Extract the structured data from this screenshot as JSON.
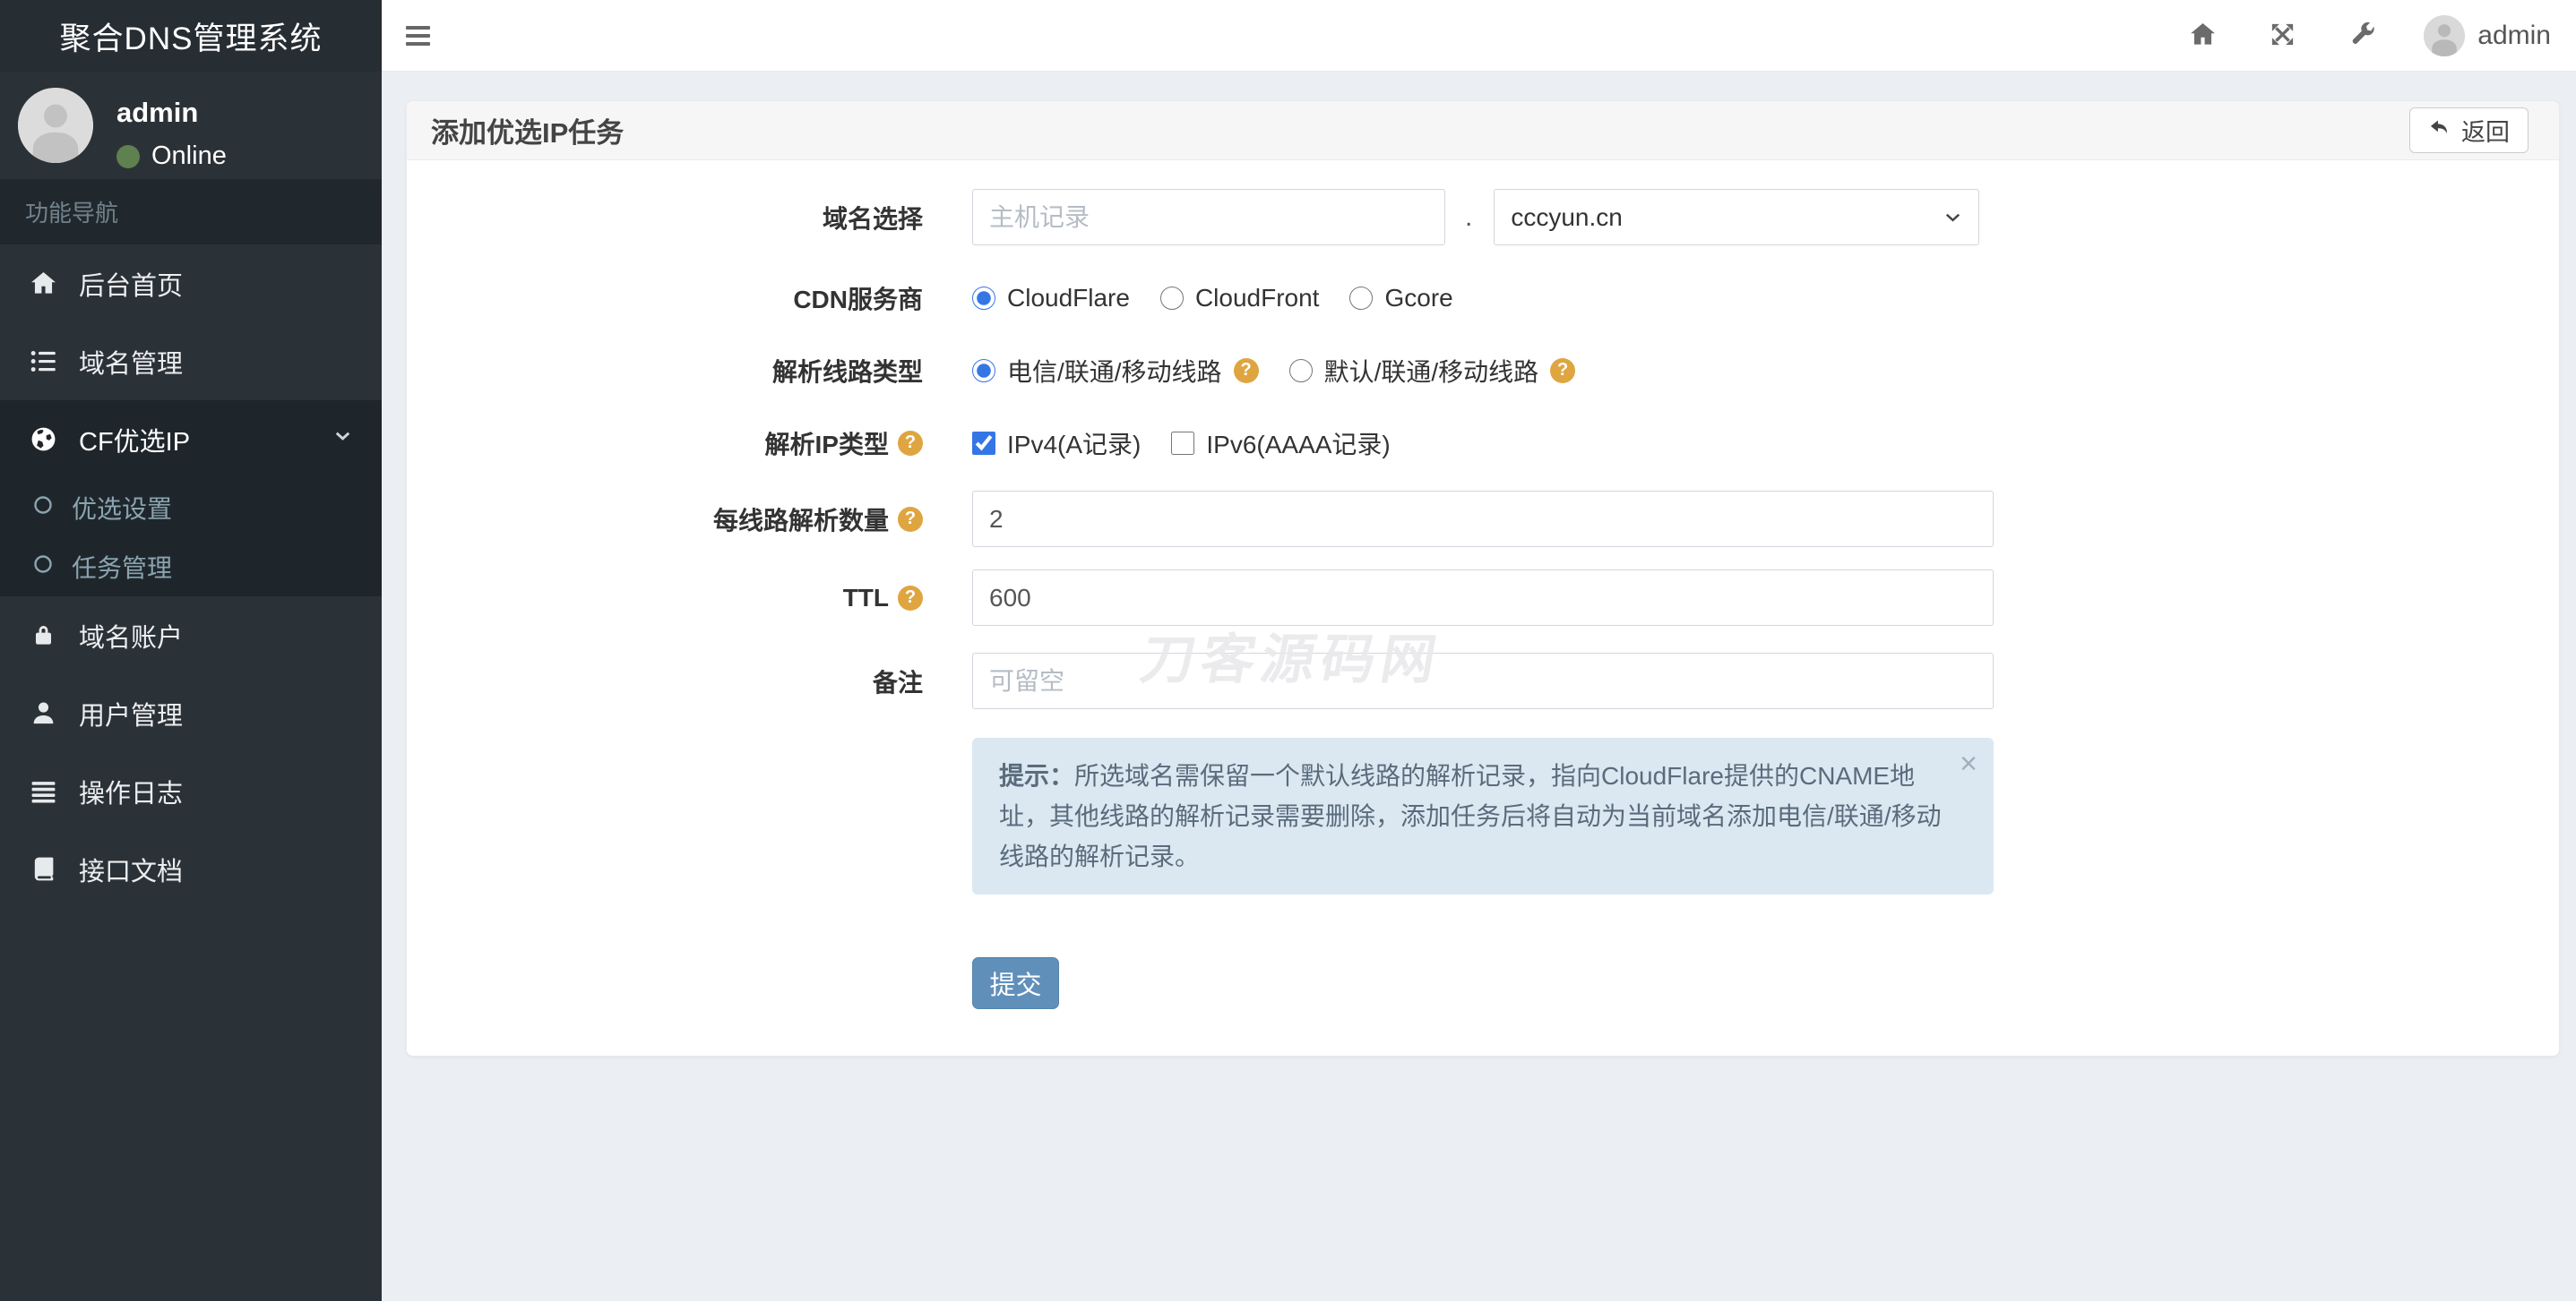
{
  "app": {
    "brand": "聚合DNS管理系统"
  },
  "navbar": {
    "username": "admin"
  },
  "sidebar": {
    "user_name": "admin",
    "user_status": "Online",
    "nav_header": "功能导航",
    "items": [
      {
        "label": "后台首页"
      },
      {
        "label": "域名管理"
      },
      {
        "label": "CF优选IP"
      },
      {
        "label": "优选设置"
      },
      {
        "label": "任务管理"
      },
      {
        "label": "域名账户"
      },
      {
        "label": "用户管理"
      },
      {
        "label": "操作日志"
      },
      {
        "label": "接口文档"
      }
    ]
  },
  "page": {
    "title": "添加优选IP任务",
    "back": "返回"
  },
  "form": {
    "help_char": "?",
    "domain": {
      "label": "域名选择",
      "host_value": "",
      "host_placeholder": "主机记录",
      "separator": ".",
      "domain_selected": "cccyun.cn"
    },
    "cdn": {
      "label": "CDN服务商",
      "options": [
        {
          "label": "CloudFlare",
          "checked": true
        },
        {
          "label": "CloudFront",
          "checked": false
        },
        {
          "label": "Gcore",
          "checked": false
        }
      ]
    },
    "line_type": {
      "label": "解析线路类型",
      "options": [
        {
          "label": "电信/联通/移动线路",
          "checked": true
        },
        {
          "label": "默认/联通/移动线路",
          "checked": false
        }
      ]
    },
    "ip_type": {
      "label": "解析IP类型",
      "options": [
        {
          "label": "IPv4(A记录)",
          "checked": true
        },
        {
          "label": "IPv6(AAAA记录)",
          "checked": false
        }
      ]
    },
    "per_line": {
      "label": "每线路解析数量",
      "value": "2"
    },
    "ttl": {
      "label": "TTL",
      "value": "600"
    },
    "remark": {
      "label": "备注",
      "value": "",
      "placeholder": "可留空"
    },
    "submit": "提交"
  },
  "hint": {
    "label": "提示：",
    "text": "所选域名需保留一个默认线路的解析记录，指向CloudFlare提供的CNAME地址，其他线路的解析记录需要删除，添加任务后将自动为当前域名添加电信/联通/移动线路的解析记录。",
    "close": "×"
  },
  "watermark": "刀客源码网",
  "colors": {
    "accent": "#3576e5",
    "submit_btn": "#608fba",
    "help_icon": "#dfa540",
    "online_dot": "#5f804f",
    "sidebar_bg": "#2b3237",
    "sidebar_active_bg": "#1f262b",
    "hint_bg": "#dbe8f2",
    "hint_text": "#5b6b7c",
    "content_bg": "#ebeef3"
  }
}
